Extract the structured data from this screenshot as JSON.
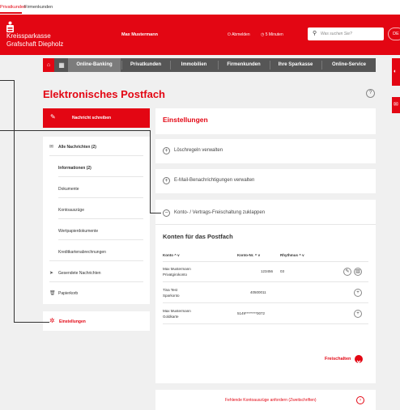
{
  "topbar": {
    "private": "Privatkunden",
    "business": "Firmenkunden"
  },
  "header": {
    "bank_line1": "Kreissparkasse",
    "bank_line2": "Grafschaft Diepholz",
    "user": "Max Mustermann",
    "logout": "Abmelden",
    "timer": "5 Minuten",
    "search_placeholder": "Was suchen Sie?",
    "lang": "DE"
  },
  "nav": {
    "items": [
      {
        "label": "Online-Banking"
      },
      {
        "label": "Privatkunden"
      },
      {
        "label": "Immobilien"
      },
      {
        "label": "Firmenkunden"
      },
      {
        "label": "Ihre Sparkasse"
      },
      {
        "label": "Online-Service"
      }
    ]
  },
  "page": {
    "title": "Elektronisches Postfach",
    "help": "?"
  },
  "sidebar": {
    "write": "Nachricht schreiben",
    "all": "Alle Nachrichten (2)",
    "folders": [
      "Informationen (2)",
      "Dokumente",
      "Kontoauszüge",
      "Wertpapierdokumente",
      "Kreditkartenabrechnungen"
    ],
    "sent": "Gesendete Nachrichten",
    "trash": "Papierkorb",
    "settings": "Einstellungen"
  },
  "main": {
    "settings_title": "Einstellungen",
    "delete_rules": "Löschregeln verwalten",
    "email_notifications": "E-Mail-Benachrichtigungen verwalten",
    "unlock_collapse": "Konto- / Vertrags-Freischaltung zuklappen",
    "accounts_title": "Konten für das Postfach",
    "columns": {
      "konto": "Konto",
      "nr": "Konto-Nr.",
      "rhythmus": "Rhythmus"
    },
    "sort_glyph": "^ v",
    "rows": [
      {
        "name": "Max Mustermann",
        "type": "Privatgirokonto",
        "nr": "123456",
        "rhythm": "03"
      },
      {
        "name": "Tina Test",
        "type": "Sparkonto",
        "nr": "40500011",
        "rhythm": ""
      },
      {
        "name": "Max Mustermann",
        "type": "Goldkarte",
        "nr": "5149********0072",
        "rhythm": ""
      }
    ],
    "unlock_button": "Freischalten",
    "missing_statements": "Fehlende Kontoauszüge anfordern (Zweitschriften)"
  },
  "icons": {
    "home": "home-icon",
    "grid": "grid-icon",
    "search": "search-icon",
    "write": "pencil-icon",
    "mail": "envelope-icon",
    "sent": "paper-plane-icon",
    "trash": "trash-icon",
    "settings": "gear-icon",
    "edit": "pencil-icon",
    "delete": "trash-icon",
    "add": "plus-icon",
    "arrow": "arrow-right-icon"
  },
  "colors": {
    "accent": "#e30613",
    "nav": "#565656"
  }
}
